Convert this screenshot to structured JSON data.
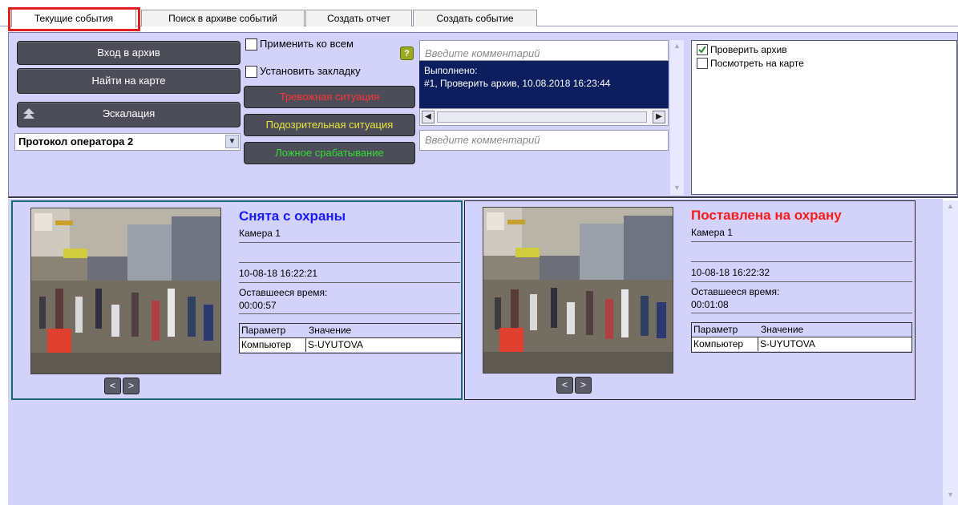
{
  "tabs": [
    {
      "label": "Текущие события"
    },
    {
      "label": "Поиск в архиве событий"
    },
    {
      "label": "Создать отчет"
    },
    {
      "label": "Создать событие"
    }
  ],
  "actions": {
    "archive_button": "Вход в архив",
    "map_button": "Найти на карте",
    "escalation_button": "Эскалация",
    "protocol_select": "Протокол оператора 2"
  },
  "options": {
    "apply_all": "Применить ко всем",
    "bookmark": "Установить закладку",
    "help": "?"
  },
  "situations": {
    "alarm": {
      "label": "Тревожная ситуация",
      "color": "#ff3333"
    },
    "suspicious": {
      "label": "Подозрительная ситуация",
      "color": "#e6e63a"
    },
    "false_alarm": {
      "label": "Ложное срабатывание",
      "color": "#33dd33"
    }
  },
  "comments": {
    "placeholder_top": "Введите комментарий",
    "done_label": "Выполнено:",
    "done_text": "#1, Проверить архив, 10.08.2018 16:23:44",
    "placeholder_bottom": "Введите комментарий"
  },
  "checklist": [
    {
      "label": "Проверить архив",
      "checked": true
    },
    {
      "label": "Посмотреть на карте",
      "checked": false
    }
  ],
  "events": [
    {
      "title": "Снята с охраны",
      "title_color": "#1a1aff",
      "camera": "Камера 1",
      "time": "10-08-18 16:22:21",
      "remaining_label": "Оставшееся время:",
      "remaining": "00:00:57",
      "param_header": "Параметр",
      "value_header": "Значение",
      "param": "Компьютер",
      "value": "S-UYUTOVA",
      "prev": "<",
      "next": ">"
    },
    {
      "title": "Поставлена на охрану",
      "title_color": "#ff1a1a",
      "camera": "Камера 1",
      "time": "10-08-18 16:22:32",
      "remaining_label": "Оставшееся время:",
      "remaining": "00:01:08",
      "param_header": "Параметр",
      "value_header": "Значение",
      "param": "Компьютер",
      "value": "S-UYUTOVA",
      "prev": "<",
      "next": ">"
    }
  ]
}
